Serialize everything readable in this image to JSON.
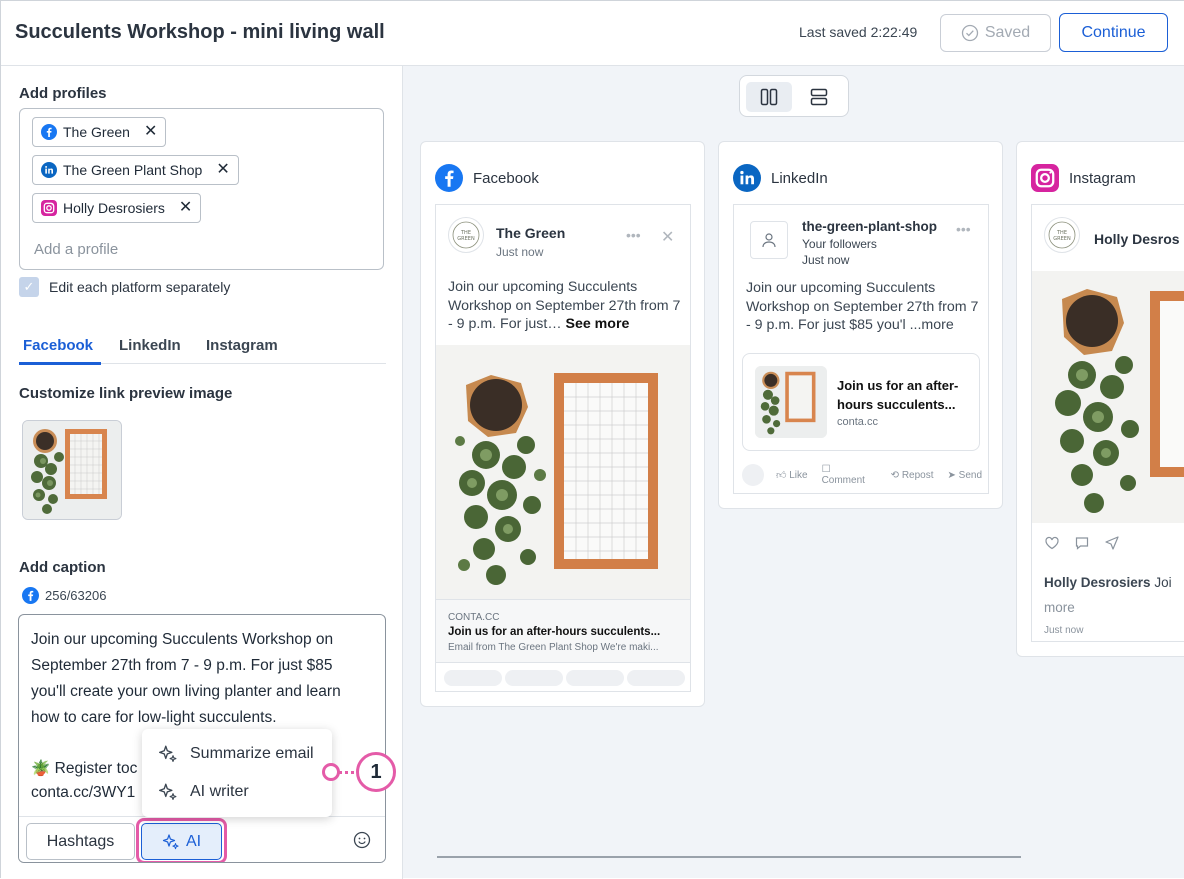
{
  "header": {
    "title": "Succulents Workshop - mini living wall",
    "last_saved": "Last saved 2:22:49",
    "saved_label": "Saved",
    "continue_label": "Continue"
  },
  "left": {
    "add_profiles_label": "Add profiles",
    "profiles": [
      {
        "name": "The Green",
        "platform": "facebook"
      },
      {
        "name": "The Green Plant Shop",
        "platform": "linkedin"
      },
      {
        "name": "Holly Desrosiers",
        "platform": "instagram"
      }
    ],
    "add_profile_placeholder": "Add a profile",
    "edit_separately_label": "Edit each platform separately",
    "tabs": [
      "Facebook",
      "LinkedIn",
      "Instagram"
    ],
    "link_preview_label": "Customize link preview image",
    "caption_label": "Add caption",
    "counter": "256/63206",
    "caption_text": "Join our upcoming Succulents Workshop on September 27th from 7 - 9 p.m. For just $85 you'll create your own living planter and learn how to care for low-light succulents.",
    "caption_register": "Register toc",
    "caption_link": "conta.cc/3WY1",
    "hashtags_label": "Hashtags",
    "ai_label": "AI",
    "ai_menu": [
      "Summarize email",
      "AI writer"
    ],
    "callout_number": "1"
  },
  "previews": {
    "facebook": {
      "network": "Facebook",
      "page_name": "The Green",
      "time": "Just now",
      "text": "Join our upcoming Succulents Workshop on September 27th from 7 - 9 p.m. For just…",
      "see_more": "See more",
      "link_domain": "CONTA.CC",
      "link_title": "Join us for an after-hours succulents...",
      "link_desc": "Email from The Green Plant Shop We're maki..."
    },
    "linkedin": {
      "network": "LinkedIn",
      "page_name": "the-green-plant-shop",
      "followers": "Your followers",
      "time": "Just now",
      "text": "Join our upcoming Succulents Workshop on September 27th from 7 - 9 p.m. For just $85 you'l ...more",
      "link_title": "Join us for an after-hours succulents...",
      "link_domain": "conta.cc",
      "actions": [
        "Like",
        "Comment",
        "Repost",
        "Send"
      ]
    },
    "instagram": {
      "network": "Instagram",
      "page_name": "Holly Desros",
      "caption_name": "Holly Desrosiers",
      "caption_rest": "Joi",
      "more": "more",
      "time": "Just now"
    }
  },
  "colors": {
    "accent": "#1b5fd6",
    "callout": "#e45ba8",
    "facebook": "#1877f2",
    "linkedin": "#0a66c2",
    "instagram": "#d6249f"
  }
}
